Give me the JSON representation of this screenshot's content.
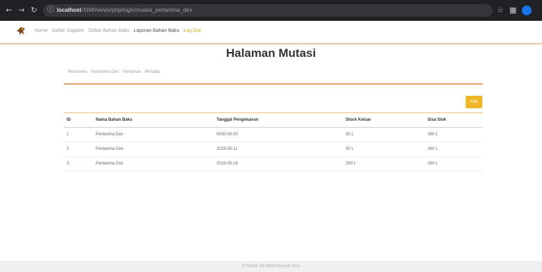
{
  "browser": {
    "url_host": "localhost",
    "url_path": "/SIMI/views/php/login/mutasi_pertamina_dex",
    "nav_icons": [
      "back-arrow-icon",
      "forward-arrow-icon",
      "reload-icon"
    ],
    "tool_icons": [
      "star-icon",
      "extension-icon"
    ]
  },
  "nav": {
    "items": [
      {
        "label": "Home",
        "style": "muted"
      },
      {
        "label": "Daftar Supplier",
        "style": "muted"
      },
      {
        "label": "Daftar Bahan Baku",
        "style": "muted"
      },
      {
        "label": "Laporan Bahan Baku",
        "style": "active"
      },
      {
        "label": "Log Out",
        "style": "logout"
      }
    ]
  },
  "page": {
    "title": "Halaman Mutasi",
    "tabs": [
      "Pertamina",
      "Pertamina Dex",
      "Pertamax",
      "Pertalite"
    ],
    "add_button": "Add"
  },
  "table": {
    "headers": [
      "ID",
      "Nama Bahan Baku",
      "Tanggal Pengeluaran",
      "Stock Keluar",
      "Sisa Stok"
    ],
    "rows": [
      [
        "1",
        "Pertamina Dex",
        "0000-00-00",
        "30 L",
        "280 L"
      ],
      [
        "2",
        "Pertamina Dex",
        "2019-05-11",
        "30 L",
        "280 L"
      ],
      [
        "3",
        "Pertamina Dex",
        "2019-05-18",
        "250 L",
        "280 L"
      ]
    ]
  },
  "footer": {
    "text": "© TEKNIK INFORMATIKA UNS 2019"
  },
  "colors": {
    "accent": "#f0b628",
    "nav_line": "#e4c8a6",
    "section_line": "#e4a066"
  }
}
